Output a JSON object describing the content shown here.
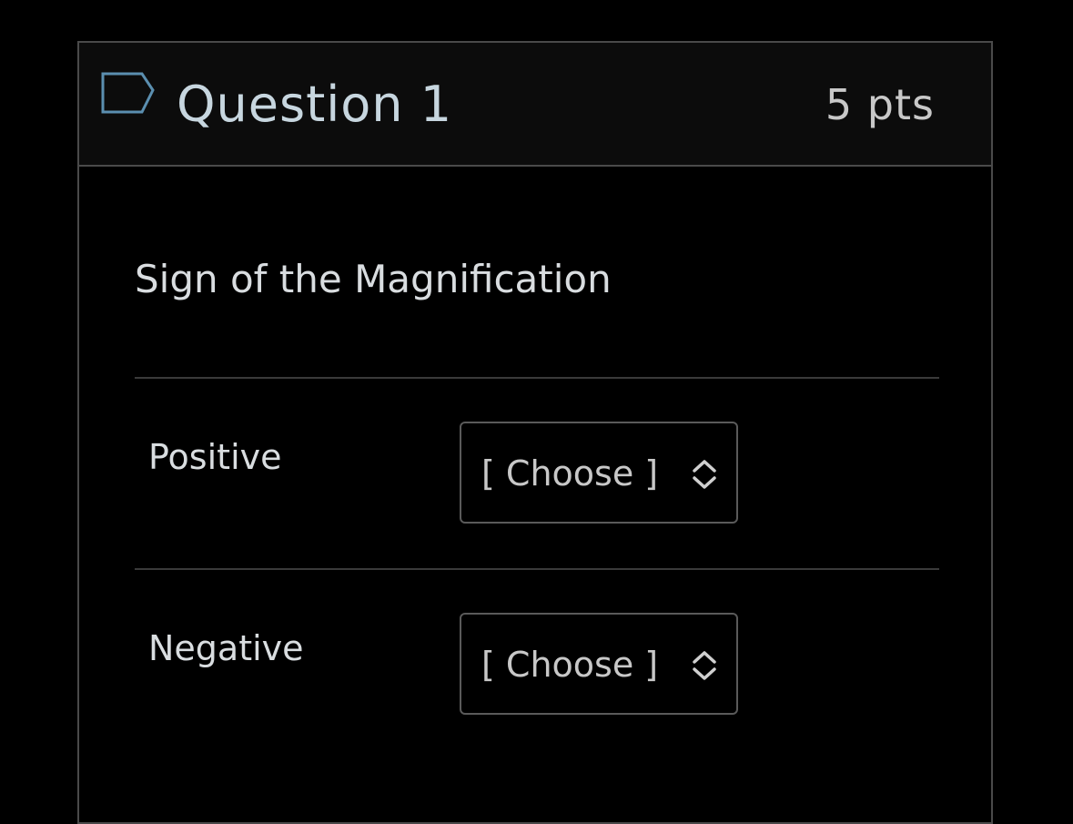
{
  "question": {
    "title": "Question 1",
    "points": "5 pts",
    "flag_icon": "flag-outline-icon",
    "text": "Sign of the Magnification"
  },
  "answers": [
    {
      "label": "Positive",
      "select_value": "[ Choose ]"
    },
    {
      "label": "Negative",
      "select_value": "[ Choose ]"
    }
  ],
  "colors": {
    "background": "#000000",
    "header_background": "#0c0c0c",
    "border": "#4a4a4a",
    "flag_stroke": "#5b8fb0",
    "title_text": "#c7d6df"
  }
}
